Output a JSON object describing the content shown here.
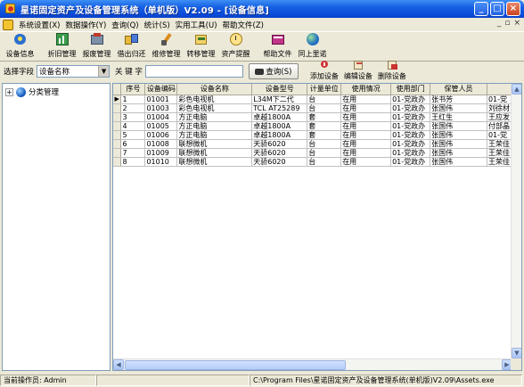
{
  "window": {
    "title": "星诺固定资产及设备管理系统（单机版）V2.09 - [设备信息]"
  },
  "menu": {
    "items": [
      "系统设置(X)",
      "数据操作(Y)",
      "查询(Q)",
      "统计(S)",
      "实用工具(U)",
      "帮助文件(Z)"
    ]
  },
  "toolbar": {
    "buttons": [
      "设备信息",
      "折旧管理",
      "报废管理",
      "借出归还",
      "维修管理",
      "转移管理",
      "资产提醒",
      "帮助文件",
      "同上里诺"
    ]
  },
  "search": {
    "field_label": "选择字段",
    "field_value": "设备名称",
    "keyword_label": "关 键 字",
    "keyword_value": "",
    "query_label": "查询(S)",
    "add_label": "添加设备",
    "edit_label": "编辑设备",
    "delete_label": "删除设备"
  },
  "tree": {
    "root_label": "分类管理",
    "expander": "+"
  },
  "grid": {
    "columns": [
      "序号",
      "设备编码",
      "设备名称",
      "设备型号",
      "计量单位",
      "使用情况",
      "使用部门",
      "保管人员",
      ""
    ],
    "rows": [
      [
        "1",
        "01001",
        "彩色电视机",
        "L34M下二代",
        "台",
        "在用",
        "01-党政办",
        "张书芳",
        "01-党"
      ],
      [
        "2",
        "01003",
        "彩色电视机",
        "TCL AT25289",
        "台",
        "在用",
        "01-党政办",
        "张国伟",
        "刘徐材"
      ],
      [
        "3",
        "01004",
        "方正电脑",
        "卓越1800A",
        "套",
        "在用",
        "01-党政办",
        "王红生",
        "王应发"
      ],
      [
        "4",
        "01005",
        "方正电脑",
        "卓越1800A",
        "套",
        "在用",
        "01-党政办",
        "张国伟",
        "付部晶"
      ],
      [
        "5",
        "01006",
        "方正电脑",
        "卓越1800A",
        "套",
        "在用",
        "01-党政办",
        "张国伟",
        "01-党"
      ],
      [
        "6",
        "01008",
        "联想微机",
        "天骄6020",
        "台",
        "在用",
        "01-党政办",
        "张国伟",
        "王荣佳"
      ],
      [
        "7",
        "01009",
        "联想微机",
        "天骄6020",
        "台",
        "在用",
        "01-党政办",
        "张国伟",
        "王荣佳"
      ],
      [
        "8",
        "01010",
        "联想微机",
        "天骄6020",
        "台",
        "在用",
        "01-党政办",
        "张国伟",
        "王荣佳"
      ]
    ],
    "current_row_marker": "▶"
  },
  "status": {
    "operator": "当前操作员: Admin",
    "path": "C:\\Program Files\\星诺固定资产及设备管理系统(单机版)V2.09\\Assets.exe"
  },
  "colors": {
    "titlebar": "#0a49d8",
    "window_bg": "#ece9d8",
    "grid_bg": "#ffffff"
  }
}
